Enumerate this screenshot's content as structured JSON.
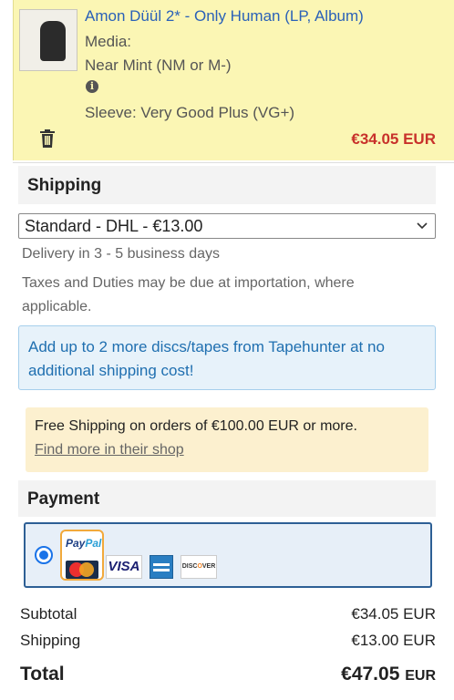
{
  "cart_item": {
    "title": "Amon Düül 2* - Only Human (LP, Album)",
    "media_label": "Media:",
    "media_condition": "Near Mint (NM or M-)",
    "sleeve": "Sleeve: Very Good Plus (VG+)",
    "price": "€34.05 EUR",
    "icons": {
      "info": "info-icon",
      "remove": "trash-icon"
    }
  },
  "shipping": {
    "heading": "Shipping",
    "selected_method": "Standard - DHL - €13.00",
    "delivery": "Delivery in 3 - 5 business days",
    "taxes_note": "Taxes and Duties may be due at importation, where applicable.",
    "info_message": "Add up to 2 more discs/tapes from Tapehunter at no additional shipping cost!",
    "promo_text": "Free Shipping on orders of €100.00 EUR or more.",
    "promo_link": "Find more in their shop"
  },
  "payment": {
    "heading": "Payment",
    "methods": [
      "PayPal",
      "MasterCard",
      "VISA",
      "American Express",
      "DISCOVER"
    ]
  },
  "totals": {
    "subtotal_label": "Subtotal",
    "subtotal_value": "€34.05 EUR",
    "shipping_label": "Shipping",
    "shipping_value": "€13.00 EUR",
    "total_label": "Total",
    "total_amount": "€47.05",
    "total_currency": "EUR"
  },
  "colors": {
    "item_bg": "#fbf6b4",
    "price_red": "#c8312b",
    "link_blue": "#2a61b8",
    "info_bg": "#e7f2fa",
    "promo_bg": "#fcf0cf",
    "payment_border": "#2d5f95"
  }
}
